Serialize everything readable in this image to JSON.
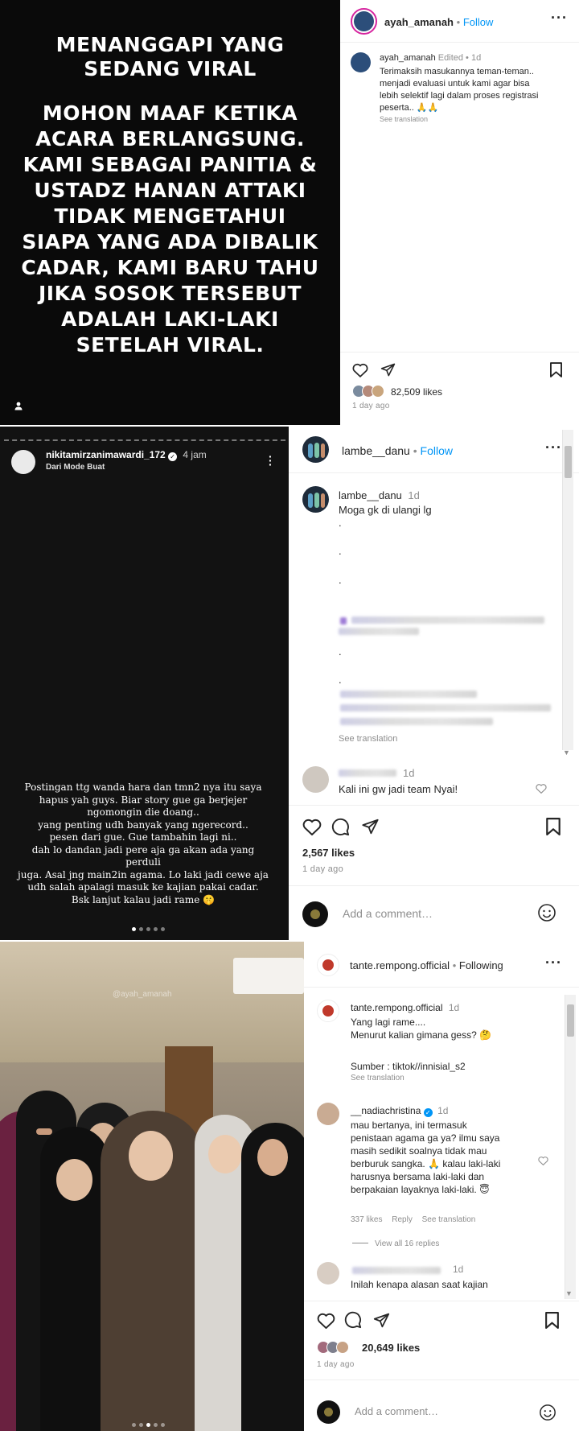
{
  "post1": {
    "story_lines": [
      "MENANGGAPI YANG",
      "SEDANG VIRAL",
      "MOHON MAAF KETIKA",
      "ACARA BERLANGSUNG.",
      "KAMI SEBAGAI PANITIA &",
      "USTADZ HANAN ATTAKI",
      "TIDAK MENGETAHUI",
      "SIAPA YANG ADA DIBALIK",
      "CADAR, KAMI BARU TAHU",
      "JIKA SOSOK TERSEBUT",
      "ADALAH LAKI-LAKI",
      "SETELAH VIRAL."
    ],
    "username": "ayah_amanah",
    "follow_sep": "•",
    "follow_label": "Follow",
    "caption_user": "ayah_amanah",
    "caption_meta": "Edited •",
    "caption_time": "1d",
    "caption_lines": [
      "Terimaksih masukannya teman-teman..",
      "menjadi evaluasi untuk kami agar bisa",
      "lebih selektif lagi dalam proses registrasi",
      "peserta.. 🙏🙏"
    ],
    "see_translation": "See translation",
    "likes": "82,509 likes",
    "time": "1 day ago"
  },
  "post2": {
    "story_user": "nikitamirzanimawardi_172",
    "story_time": "4 jam",
    "story_sub": "Dari Mode Buat",
    "story_lines": [
      "Postingan ttg wanda hara dan tmn2 nya itu saya",
      "hapus yah guys. Biar story gue ga berjejer",
      "ngomongin die doang..",
      "yang penting udh banyak yang ngerecord..",
      "pesen dari gue. Gue tambahin lagi ni..",
      "dah lo dandan jadi pere aja ga akan ada yang perduli",
      "juga. Asal jng main2in agama. Lo laki jadi cewe aja",
      "udh salah apalagi masuk ke kajian pakai cadar.",
      "Bsk lanjut kalau jadi rame 🤫"
    ],
    "username": "lambe__danu",
    "follow_sep": "•",
    "follow_label": "Follow",
    "caption_user": "lambe__danu",
    "caption_time": "1d",
    "caption_text": "Moga gk di ulangi lg",
    "dot": ".",
    "see_translation": "See translation",
    "comment_time": "1d",
    "comment_text": "Kali ini gw jadi team Nyai!",
    "likes": "2,567 likes",
    "time": "1 day ago",
    "add_comment": "Add a comment…"
  },
  "post3": {
    "watermark": "@ayah_amanah",
    "username": "tante.rempong.official",
    "follow_sep": "•",
    "follow_label": "Following",
    "caption_user": "tante.rempong.official",
    "caption_time": "1d",
    "caption_lines": [
      "Yang lagi rame....",
      "Menurut kalian gimana gess? 🤔"
    ],
    "source": "Sumber : tiktok//innisial_s2",
    "see_translation": "See translation",
    "c1_user": "__nadiachristina",
    "c1_time": "1d",
    "c1_lines": [
      "mau bertanya, ini termasuk",
      "penistaan agama ga ya? ilmu saya",
      "masih sedikit soalnya tidak mau",
      "berburuk sangka. 🙏 kalau laki-laki",
      "harusnya bersama laki-laki dan",
      "berpakaian layaknya laki-laki. 😇"
    ],
    "c1_likes": "337 likes",
    "c1_reply": "Reply",
    "c1_translation": "See translation",
    "view_replies": "View all 16 replies",
    "c2_time": "1d",
    "c2_text": "Inilah kenapa alasan saat kajian",
    "likes": "20,649 likes",
    "time": "1 day ago",
    "add_comment": "Add a comment…"
  },
  "colors": {
    "link": "#0095f6",
    "text": "#262626",
    "muted": "#8e8e8e",
    "verified": "#0095f6"
  }
}
